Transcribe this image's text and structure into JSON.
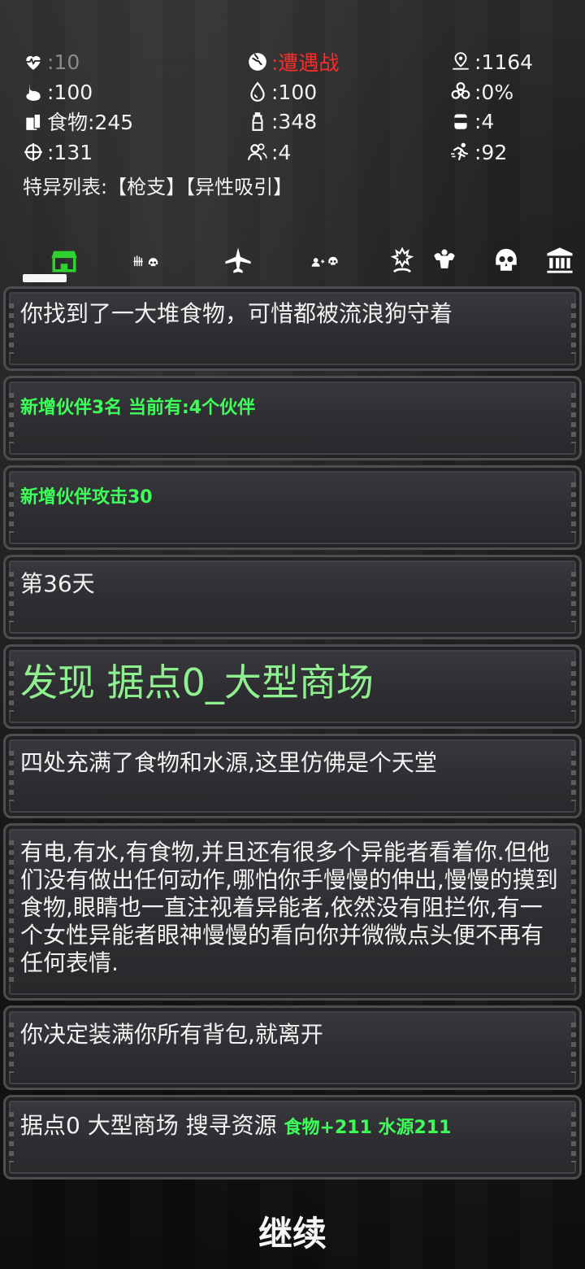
{
  "stats": {
    "health": ":10",
    "encounter": ":遭遇战",
    "distance": ":1164",
    "stomach": ":100",
    "water": ":100",
    "infection": ":0%",
    "food": "食物:245",
    "bottle": ":348",
    "can": ":4",
    "attack": ":131",
    "companions": ":4",
    "speed": ":92"
  },
  "traits": "特异列表:【枪支】【异性吸引】",
  "tabs": [
    {
      "icon": "shop-icon"
    },
    {
      "icon": "weapons-skull-icon"
    },
    {
      "icon": "plane-icon"
    },
    {
      "icon": "add-companion-skull-icon"
    },
    {
      "icon": "heal-skull-icon"
    },
    {
      "icon": "strength-skull-icon"
    },
    {
      "icon": "bank-icon"
    }
  ],
  "log": [
    {
      "text": "你找到了一大堆食物，可惜都被流浪狗守着"
    },
    {
      "text": "新增伙伴3名  当前有:4个伙伴"
    },
    {
      "text": "新增伙伴攻击30"
    },
    {
      "text": "第36天"
    },
    {
      "text": "发现 据点0_大型商场"
    },
    {
      "text": "四处充满了食物和水源,这里仿佛是个天堂"
    },
    {
      "text": "有电,有水,有食物,并且还有很多个异能者看着你.但他们没有做出任何动作,哪怕你手慢慢的伸出,慢慢的摸到食物,眼睛也一直注视着异能者,依然没有阻拦你,有一个女性异能者眼神慢慢的看向你并微微点头便不再有任何表情."
    },
    {
      "text": "你决定装满你所有背包,就离开"
    },
    {
      "text": "据点0 大型商场 搜寻资源 ",
      "extra": "食物+211  水源211"
    }
  ],
  "continue_label": "继续",
  "colors": {
    "highlight_green": "#3dff5a",
    "title_green": "#8ff08f",
    "alert_red": "#ff2a2a"
  }
}
